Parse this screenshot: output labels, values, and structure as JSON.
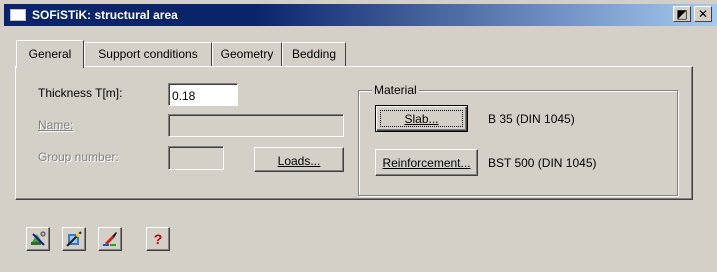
{
  "window": {
    "title": "SOFiSTiK: structural area"
  },
  "titlebar_buttons": {
    "pin": "◩",
    "close": "✕"
  },
  "tabs": [
    {
      "label": "General",
      "active": true
    },
    {
      "label": "Support conditions",
      "active": false
    },
    {
      "label": "Geometry",
      "active": false
    },
    {
      "label": "Bedding",
      "active": false
    }
  ],
  "general": {
    "thickness_label": "Thickness T[m]:",
    "thickness_value": "0.18",
    "name_label": "Name:",
    "name_value": "",
    "group_label": "Group number:",
    "group_value": "",
    "loads_button": "Loads..."
  },
  "material": {
    "title": "Material",
    "slab_button": "Slab...",
    "slab_value": "B 35 (DIN 1045)",
    "reinforcement_button": "Reinforcement...",
    "reinforcement_value": "BST 500 (DIN 1045)"
  },
  "toolbar": {
    "icons": [
      "tools-icon",
      "wizard-icon",
      "paint-icon",
      "help-icon"
    ],
    "help_glyph": "?"
  },
  "colors": {
    "title_bar_start": "#0a246a",
    "title_bar_end": "#a6caf0",
    "face": "#d4d0c8",
    "help_glyph": "#c00000"
  }
}
